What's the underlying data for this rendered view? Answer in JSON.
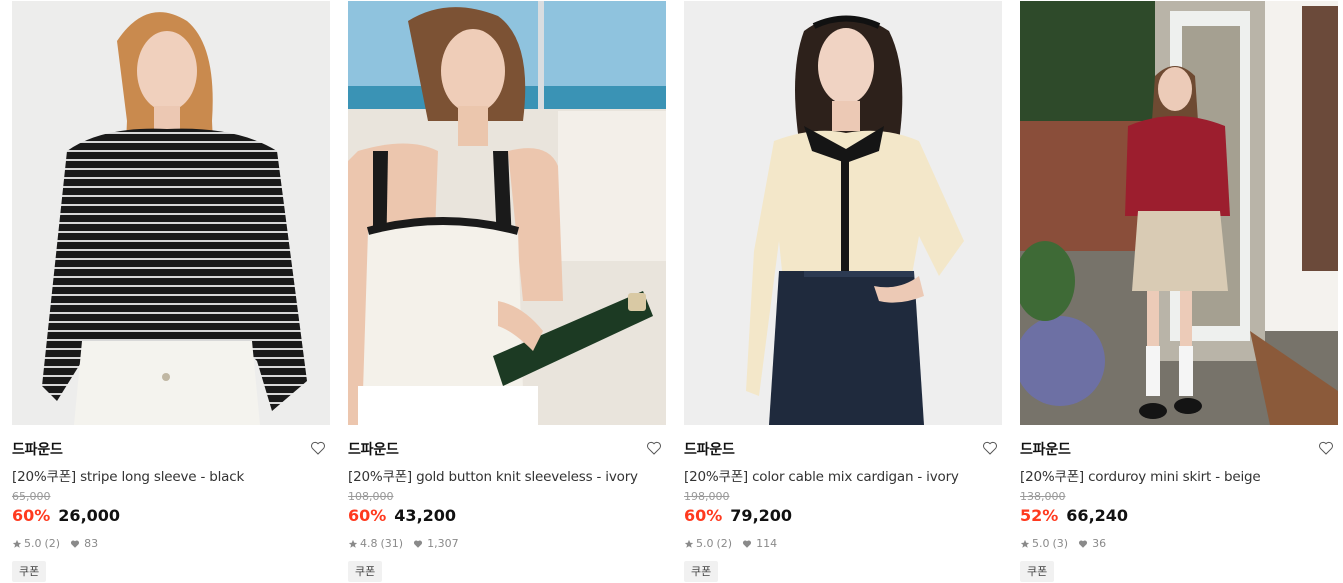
{
  "products": [
    {
      "brand": "드파운드",
      "name": "[20%쿠폰] stripe long sleeve - black",
      "original_price": "65,000",
      "discount": "60%",
      "price": "26,000",
      "rating": "5.0",
      "reviews": "(2)",
      "likes": "83",
      "badge": "쿠폰",
      "image_alt": "Woman with long hair in black and white striped long sleeve top and white pants"
    },
    {
      "brand": "드파운드",
      "name": "[20%쿠폰] gold button knit sleeveless - ivory",
      "original_price": "108,000",
      "discount": "60%",
      "price": "43,200",
      "rating": "4.8",
      "reviews": "(31)",
      "likes": "1,307",
      "badge": "쿠폰",
      "image_alt": "Woman in ivory knit sleeveless top with black trim holding a champagne bottle"
    },
    {
      "brand": "드파운드",
      "name": "[20%쿠폰] color cable mix cardigan - ivory",
      "original_price": "198,000",
      "discount": "60%",
      "price": "79,200",
      "rating": "5.0",
      "reviews": "(2)",
      "likes": "114",
      "badge": "쿠폰",
      "image_alt": "Woman in ivory cable knit cardigan with black collar and denim skirt"
    },
    {
      "brand": "드파운드",
      "name": "[20%쿠폰] corduroy mini skirt - beige",
      "original_price": "138,000",
      "discount": "52%",
      "price": "66,240",
      "rating": "5.0",
      "reviews": "(3)",
      "likes": "36",
      "badge": "쿠폰",
      "image_alt": "Woman in red sweater and beige corduroy mini skirt standing in a garden courtyard"
    }
  ],
  "icons": {
    "like": "heart-outline-icon",
    "rating": "star-icon",
    "likes": "heart-filled-icon"
  },
  "colors": {
    "discount": "#ff3a1f",
    "badge_bg": "#f1f1f1",
    "muted": "#8a8a8a"
  }
}
